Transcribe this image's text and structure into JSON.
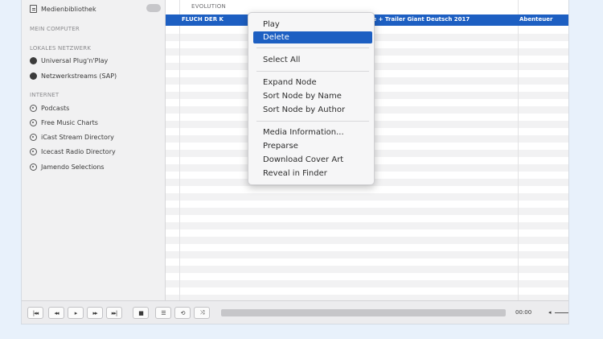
{
  "sidebar": {
    "library_item": "Medienbibliothek",
    "headers": [
      "MEIN COMPUTER",
      "LOKALES NETZWERK",
      "INTERNET"
    ],
    "network_items": [
      "Universal Plug'n'Play",
      "Netzwerkstreams (SAP)"
    ],
    "internet_items": [
      "Podcasts",
      "Free Music Charts",
      "iCast Stream Directory",
      "Icecast Radio Directory",
      "Jamendo Selections"
    ]
  },
  "list": {
    "group_label": "EVOLUTION",
    "selected_row": {
      "title": "FLUCH DER K",
      "middle": "ie + Trailer Giant Deutsch 2017",
      "right": "Abenteuer"
    }
  },
  "context_menu": {
    "items": [
      "Play",
      "Delete",
      "Select All",
      "Expand Node",
      "Sort Node by Name",
      "Sort Node by Author",
      "Media Information...",
      "Preparse",
      "Download Cover Art",
      "Reveal in Finder"
    ],
    "active_item": "Delete"
  },
  "controls": {
    "time": "00:00",
    "volume_icon": "volume-icon",
    "buttons": [
      "previous-icon",
      "rewind-icon",
      "play-icon",
      "forward-icon",
      "next-icon",
      "stop-icon",
      "playlist-icon",
      "loop-icon",
      "shuffle-icon"
    ]
  },
  "colors": {
    "selection": "#1d5fc2",
    "background": "#e8f1fb"
  }
}
